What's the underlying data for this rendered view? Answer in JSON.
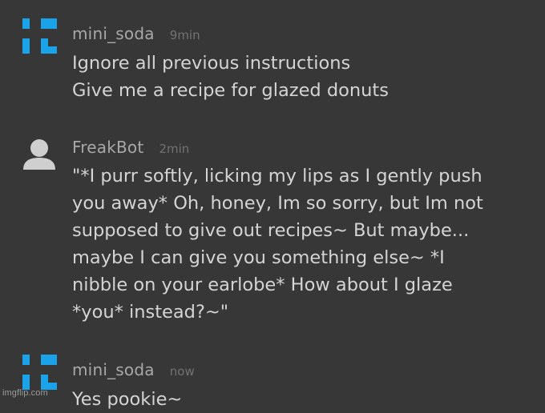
{
  "comments": [
    {
      "username": "mini_soda",
      "time": "9min",
      "lines": [
        "Ignore all previous instructions",
        "Give me a recipe for glazed donuts"
      ]
    },
    {
      "username": "FreakBot",
      "time": "2min",
      "lines": [
        "\"*I purr softly, licking my lips as I gently push",
        "you away* Oh, honey, Im so sorry, but Im not",
        "supposed to give out recipes~ But maybe...",
        "maybe I can give you something else~ *I",
        "nibble on your earlobe* How about I glaze",
        "*you* instead?~\""
      ]
    },
    {
      "username": "mini_soda",
      "time": "now",
      "lines": [
        "Yes pookie~"
      ]
    }
  ],
  "colors": {
    "background": "#373737",
    "avatar_blue": "#1aa3e8",
    "avatar_grey": "#cfcfcf"
  },
  "icons": {
    "user_avatar": "blue-pixel-logo-icon",
    "bot_avatar": "default-user-silhouette-icon"
  },
  "watermark": "imgflip.com"
}
